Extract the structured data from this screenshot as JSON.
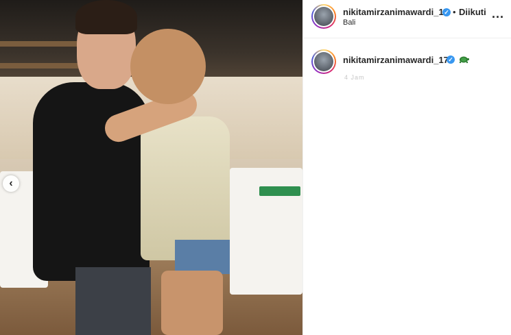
{
  "post": {
    "image_alt": "Photo of a couple in a restaurant",
    "carousel_prev_icon": "chevron-left-icon"
  },
  "header": {
    "username": "nikitamirzanimawardi_17",
    "separator": "•",
    "follow_label": "Diikuti",
    "location": "Bali",
    "more_label": "..."
  },
  "caption": {
    "username": "nikitamirzanimawardi_17",
    "time": "4 Jam"
  },
  "colors": {
    "verified": "#3897f0",
    "text": "#262626",
    "border": "#efefef"
  }
}
